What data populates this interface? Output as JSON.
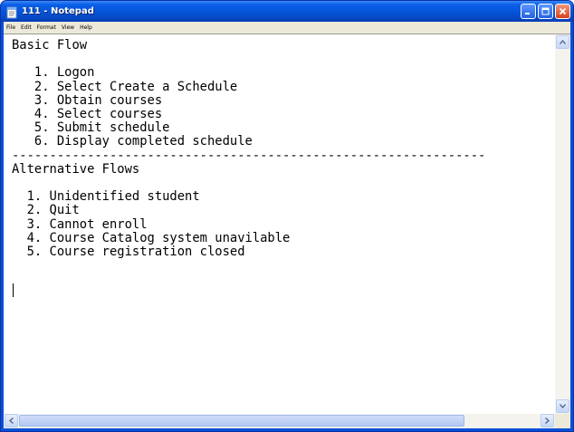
{
  "window": {
    "title": "111 - Notepad",
    "colors": {
      "titlebar": "#0553d6",
      "menubar": "#ece9d8",
      "close": "#d8421f"
    }
  },
  "menu": [
    "File",
    "Edit",
    "Format",
    "View",
    "Help"
  ],
  "document": {
    "lines": [
      "Basic Flow",
      "",
      "   1. Logon",
      "   2. Select Create a Schedule",
      "   3. Obtain courses",
      "   4. Select courses",
      "   5. Submit schedule",
      "   6. Display completed schedule",
      "---------------------------------------------------------------",
      "Alternative Flows",
      "",
      "  1. Unidentified student",
      "  2. Quit",
      "  3. Cannot enroll",
      "  4. Course Catalog system unavilable",
      "  5. Course registration closed"
    ]
  },
  "icons": {
    "app": "notepad-icon",
    "minimize": "minimize-icon",
    "maximize": "maximize-icon",
    "close": "close-icon"
  }
}
